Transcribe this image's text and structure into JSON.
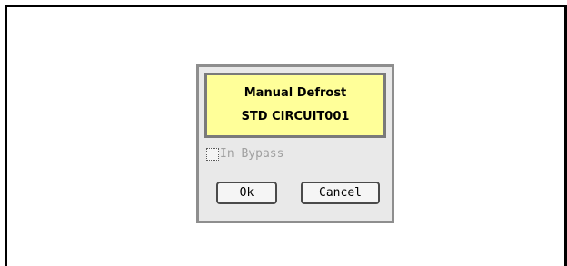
{
  "dialog": {
    "title_line1": "Manual Defrost",
    "title_line2": "STD CIRCUIT001",
    "bypass_label": "In Bypass",
    "bypass_checked": false,
    "ok_label": "Ok",
    "cancel_label": "Cancel"
  },
  "colors": {
    "title_background": "#ffff99",
    "dialog_background": "#e9e9e9",
    "disabled_text": "#a0a0a0"
  }
}
